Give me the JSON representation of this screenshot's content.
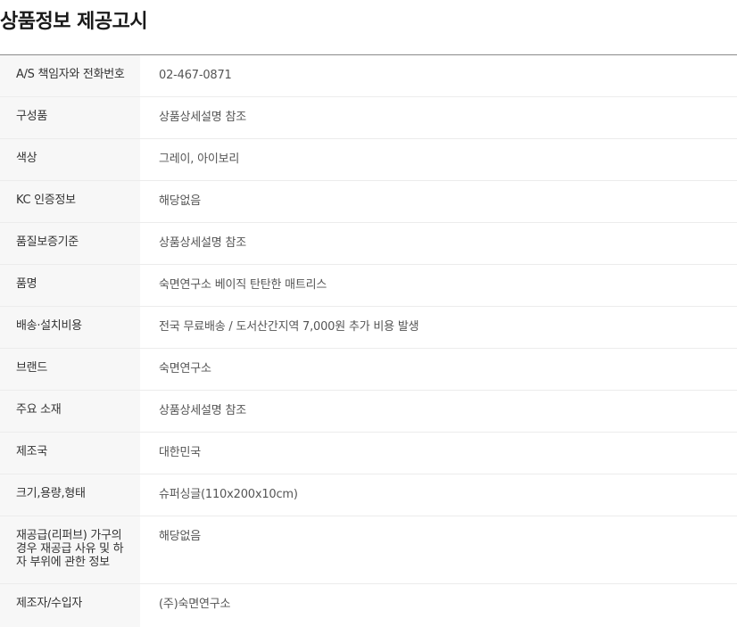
{
  "title": "상품정보 제공고시",
  "rows": [
    {
      "label": "A/S 책임자와 전화번호",
      "value": "02-467-0871"
    },
    {
      "label": "구성품",
      "value": "상품상세설명 참조"
    },
    {
      "label": "색상",
      "value": "그레이, 아이보리"
    },
    {
      "label": "KC 인증정보",
      "value": "해당없음"
    },
    {
      "label": "품질보증기준",
      "value": "상품상세설명 참조"
    },
    {
      "label": "품명",
      "value": "숙면연구소 베이직 탄탄한 매트리스"
    },
    {
      "label": "배송·설치비용",
      "value": "전국 무료배송 / 도서산간지역 7,000원 추가 비용 발생"
    },
    {
      "label": "브랜드",
      "value": "숙면연구소"
    },
    {
      "label": "주요 소재",
      "value": "상품상세설명 참조"
    },
    {
      "label": "제조국",
      "value": "대한민국"
    },
    {
      "label": "크기,용량,형태",
      "value": "슈퍼싱글(110x200x10cm)"
    },
    {
      "label": "재공급(리퍼브) 가구의 경우 재공급 사유 및 하자 부위에 관한 정보",
      "value": "해당없음"
    },
    {
      "label": "제조자/수입자",
      "value": "(주)숙면연구소"
    }
  ]
}
